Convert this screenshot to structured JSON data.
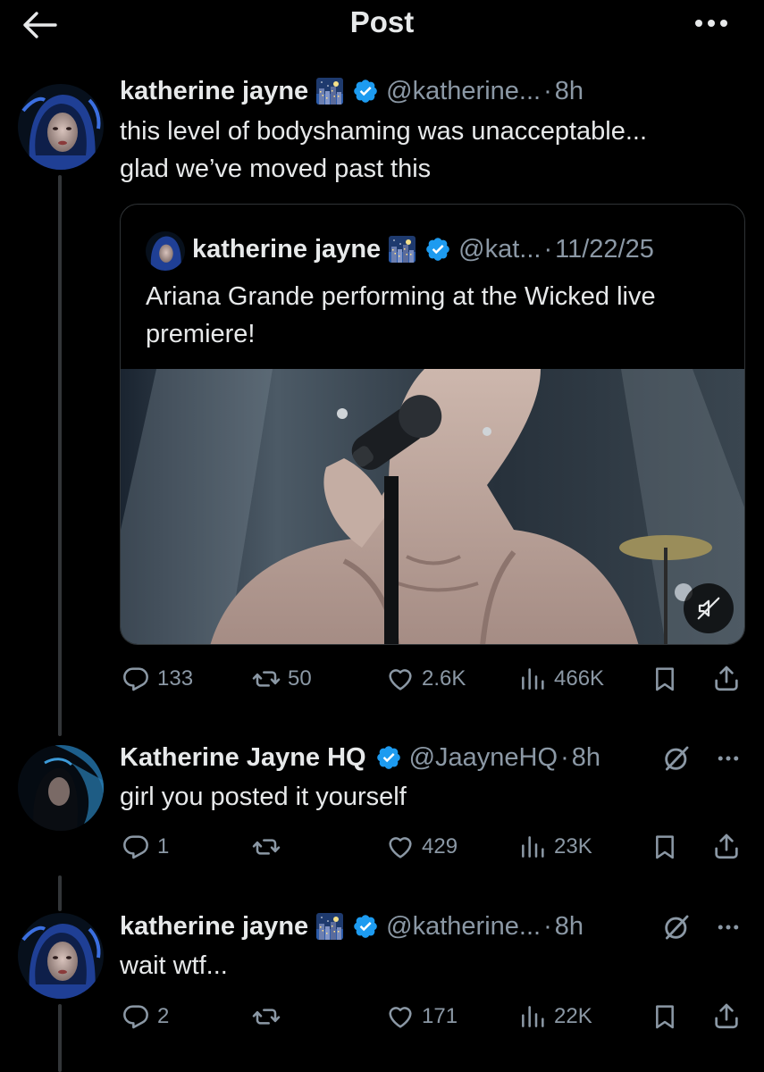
{
  "header": {
    "title": "Post"
  },
  "main_post": {
    "name": "katherine jayne",
    "handle": "@katherine...",
    "time": "8h",
    "text_line1": "this level of bodyshaming was unacceptable...",
    "text_line2": "glad we’ve moved past this",
    "quote": {
      "name": "katherine jayne",
      "handle": "@kat...",
      "date": "11/22/25",
      "text_line1": "Ariana Grande performing at the Wicked live",
      "text_line2": "premiere!"
    },
    "stats": {
      "replies": "133",
      "reposts": "50",
      "likes": "2.6K",
      "views": "466K"
    }
  },
  "replies": [
    {
      "name": "Katherine Jayne HQ",
      "handle": "@JaayneHQ",
      "time": "8h",
      "text": "girl you posted it yourself",
      "stats": {
        "replies": "1",
        "reposts": "",
        "likes": "429",
        "views": "23K"
      }
    },
    {
      "name": "katherine jayne",
      "handle": "@katherine...",
      "time": "8h",
      "text": "wait wtf...",
      "stats": {
        "replies": "2",
        "reposts": "",
        "likes": "171",
        "views": "22K"
      }
    }
  ],
  "icons": {
    "back": "arrow-left-icon",
    "more": "more-horizontal-icon",
    "verified": "verified-badge-icon",
    "reply": "reply-icon",
    "repost": "repost-icon",
    "like": "heart-icon",
    "views": "views-icon",
    "bookmark": "bookmark-icon",
    "share": "share-icon",
    "mute": "mute-icon",
    "grok": "grok-icon"
  },
  "colors": {
    "background": "#000000",
    "text": "#e7e9ea",
    "secondary": "#8b98a5",
    "verified": "#1d9bf0",
    "border": "#2f3336"
  }
}
